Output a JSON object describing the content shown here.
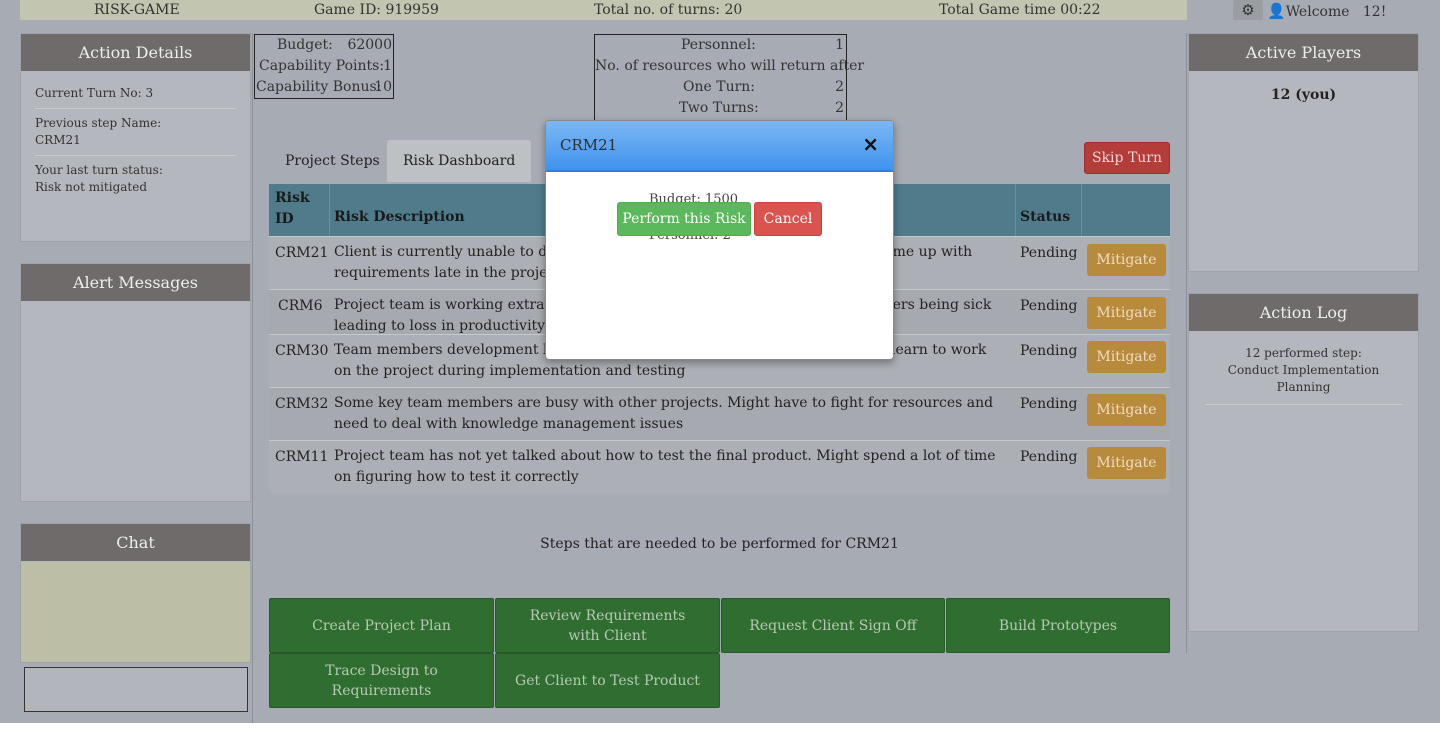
{
  "topbar": {
    "app_name": "RISK-GAME",
    "game_id": "Game ID: 919959",
    "total_turns": "Total no. of turns:  20",
    "total_time": "Total Game time 00:22",
    "welcome": "Welcome",
    "user": "12!"
  },
  "action_details": {
    "title": "Action Details",
    "current_turn": "Current  Turn No: 3",
    "prev_step_label": "Previous  step Name:",
    "prev_step_value": "CRM21",
    "last_status_label": "Your last turn  status:",
    "last_status_value": "Risk not mitigated"
  },
  "alert_messages": {
    "title": "Alert Messages"
  },
  "chat": {
    "title": "Chat"
  },
  "resources": {
    "budget_label": "Budget:",
    "budget_value": "62000",
    "cap_points_label": "Capability  Points:",
    "cap_points_value": "1",
    "cap_bonus_label": "Capability  Bonus:",
    "cap_bonus_value": "10"
  },
  "personnel": {
    "personnel_label": "Personnel:",
    "personnel_value": "1",
    "return_label": "No. of resources  who will return  after",
    "one_turn_label": "One Turn:",
    "one_turn_value": "2",
    "two_turns_label": "Two Turns:",
    "two_turns_value": "2"
  },
  "tabs": {
    "project_steps": "Project Steps",
    "risk_dashboard": "Risk Dashboard"
  },
  "skip_turn": "Skip Turn",
  "risk_table": {
    "headers": {
      "risk_id_1": "Risk",
      "risk_id_2": "ID",
      "description": "Risk Description",
      "status": "Status"
    },
    "mitigate_label": "Mitigate",
    "rows": [
      {
        "id": "CRM21",
        "desc": "Client  is currently  unable  to define  what they want from the product, might  come up with requirements  late in the project for this important  information",
        "status": "Pending"
      },
      {
        "id": "CRM6",
        "desc": "Project team is working  extra hours and is stressed.  Might lead to team members  being sick leading to loss in productivity",
        "status": "Pending"
      },
      {
        "id": "CRM30",
        "desc": "Team members  development  background  is not adequate.  Might need time to learn to work on the project during implementation   and testing",
        "status": "Pending"
      },
      {
        "id": "CRM32",
        "desc": "Some key team members  are busy  with other projects. Might  have to fight  for resources  and need to deal  with knowledge   management   issues",
        "status": "Pending"
      },
      {
        "id": "CRM11",
        "desc": "Project team has  not yet talked  about  how  to test the final product.  Might  spend  a lot of time  on figuring  how  to test it correctly",
        "status": "Pending"
      }
    ]
  },
  "steps_title": "Steps  that  are needed   to be performed   for CRM21",
  "steps": [
    "Create  Project Plan",
    "Review  Requirements   with Client",
    "Request  Client  Sign Off",
    "Build Prototypes",
    "Trace Design  to Requirements",
    "Get Client  to Test Product"
  ],
  "active_players": {
    "title": "Active  Players",
    "player": "12 (you)"
  },
  "action_log": {
    "title": "Action  Log",
    "entry": "12 performed   step:  Conduct Implementation   Planning"
  },
  "modal": {
    "title": "CRM21",
    "close": "×",
    "budget": "Budget:       1500",
    "personnel": "Personnel:      2",
    "perform": "Perform  this Risk",
    "cancel": "Cancel"
  },
  "colors": {
    "modal_header": "#3f93ee",
    "perform": "#5cb85c",
    "cancel": "#d9534f",
    "mitigate": "#b88a3c",
    "step": "#2f6e30",
    "skip": "#b43c39"
  }
}
